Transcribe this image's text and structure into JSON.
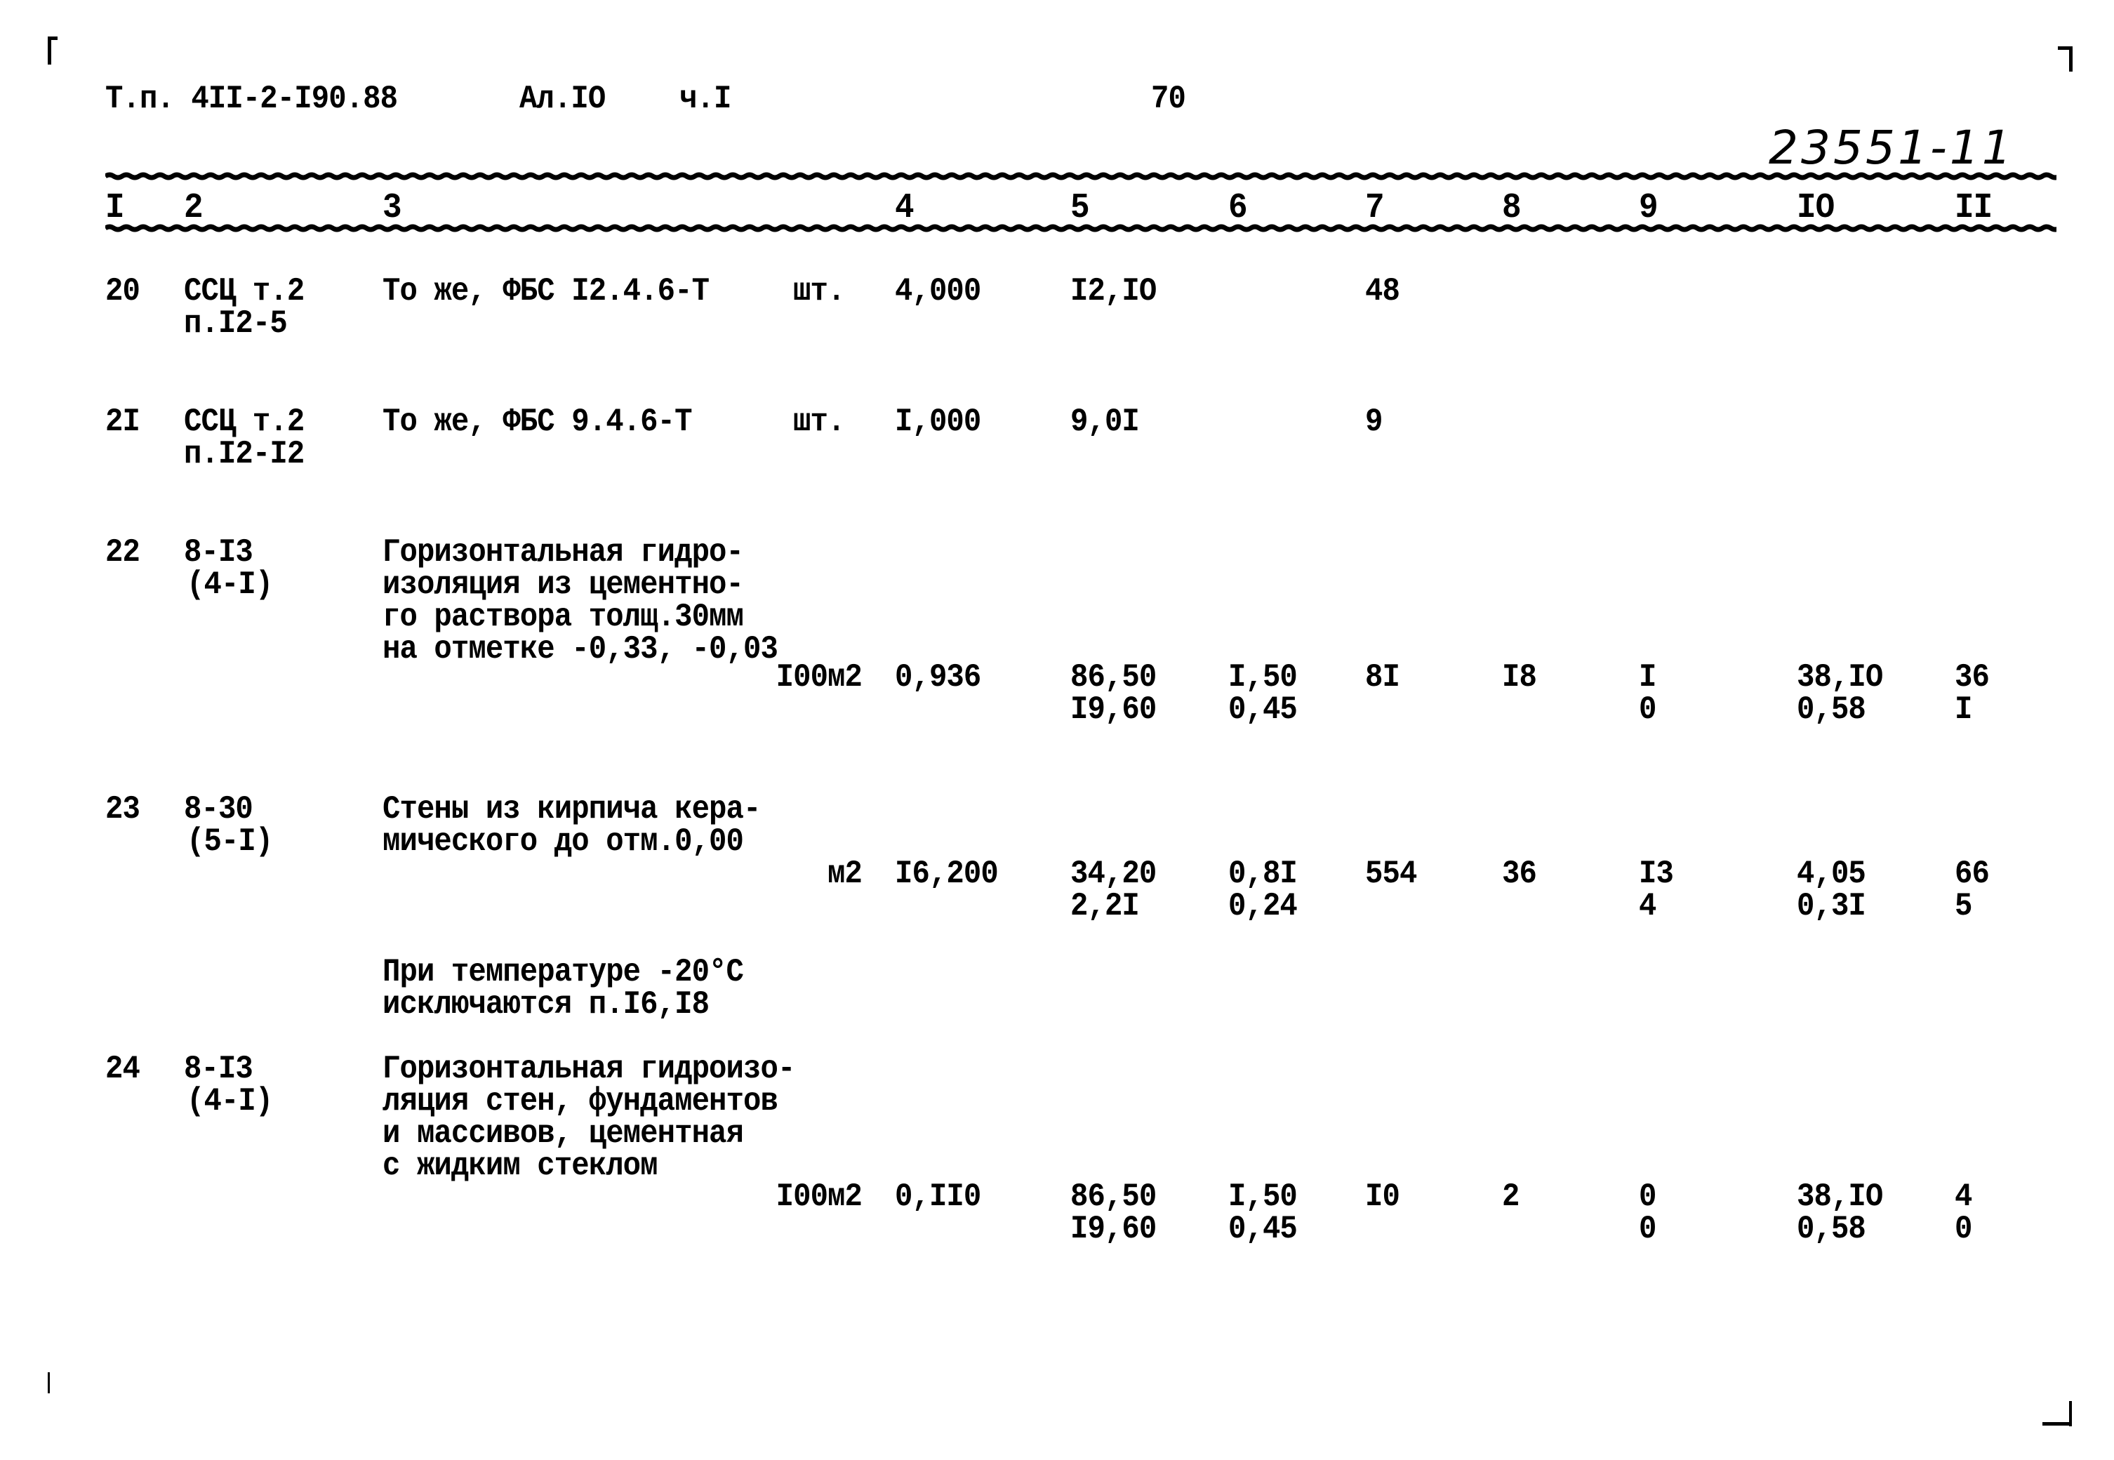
{
  "header": {
    "doc_code": "Т.п. 4II-2-I90.88",
    "album": "Ал.IO",
    "part": "ч.I",
    "page_number": "70",
    "stamp": "23551-11"
  },
  "columns": [
    "I",
    "2",
    "3",
    "4",
    "5",
    "6",
    "7",
    "8",
    "9",
    "IO",
    "II"
  ],
  "rows": [
    {
      "num": "20",
      "code": [
        "ССЦ т.2",
        "п.I2-5"
      ],
      "description": [
        "То же, ФБС I2.4.6-Т"
      ],
      "unit": "шт.",
      "qty": "4,000",
      "c5": [
        "I2,IO",
        ""
      ],
      "c6": [
        "",
        ""
      ],
      "c7": "48",
      "c8": "",
      "c9": [
        "",
        ""
      ],
      "c10": [
        "",
        ""
      ],
      "c11": [
        "",
        ""
      ]
    },
    {
      "num": "2I",
      "code": [
        "ССЦ т.2",
        "п.I2-I2"
      ],
      "description": [
        "То же, ФБС 9.4.6-Т"
      ],
      "unit": "шт.",
      "qty": "I,000",
      "c5": [
        "9,0I",
        ""
      ],
      "c6": [
        "",
        ""
      ],
      "c7": "9",
      "c8": "",
      "c9": [
        "",
        ""
      ],
      "c10": [
        "",
        ""
      ],
      "c11": [
        "",
        ""
      ]
    },
    {
      "num": "22",
      "code": [
        "8-I3",
        "(4-I)"
      ],
      "description": [
        "Горизонтальная гидро-",
        "изоляция из цементно-",
        "го раствора толщ.30мм",
        "на отметке -0,33, -0,03"
      ],
      "unit": "I00м2",
      "qty": "0,936",
      "c5": [
        "86,50",
        "I9,60"
      ],
      "c6": [
        "I,50",
        "0,45"
      ],
      "c7": "8I",
      "c8": "I8",
      "c9": [
        "I",
        "0"
      ],
      "c10": [
        "38,IO",
        "0,58"
      ],
      "c11": [
        "36",
        "I"
      ]
    },
    {
      "num": "23",
      "code": [
        "8-30",
        "(5-I)"
      ],
      "description": [
        "Стены из кирпича кера-",
        "мического до отм.0,00"
      ],
      "unit": "м2",
      "qty": "I6,200",
      "c5": [
        "34,20",
        "2,2I"
      ],
      "c6": [
        "0,8I",
        "0,24"
      ],
      "c7": "554",
      "c8": "36",
      "c9": [
        "I3",
        "4"
      ],
      "c10": [
        "4,05",
        "0,3I"
      ],
      "c11": [
        "66",
        "5"
      ],
      "note": [
        "При температуре -20°C",
        "исключаются п.I6,I8"
      ]
    },
    {
      "num": "24",
      "code": [
        "8-I3",
        "(4-I)"
      ],
      "description": [
        "Горизонтальная гидроизо-",
        "ляция стен, фундаментов",
        "и массивов, цементная",
        "с жидким стеклом"
      ],
      "unit": "I00м2",
      "qty": "0,II0",
      "c5": [
        "86,50",
        "I9,60"
      ],
      "c6": [
        "I,50",
        "0,45"
      ],
      "c7": "I0",
      "c8": "2",
      "c9": [
        "0",
        "0"
      ],
      "c10": [
        "38,IO",
        "0,58"
      ],
      "c11": [
        "4",
        "0"
      ]
    }
  ]
}
